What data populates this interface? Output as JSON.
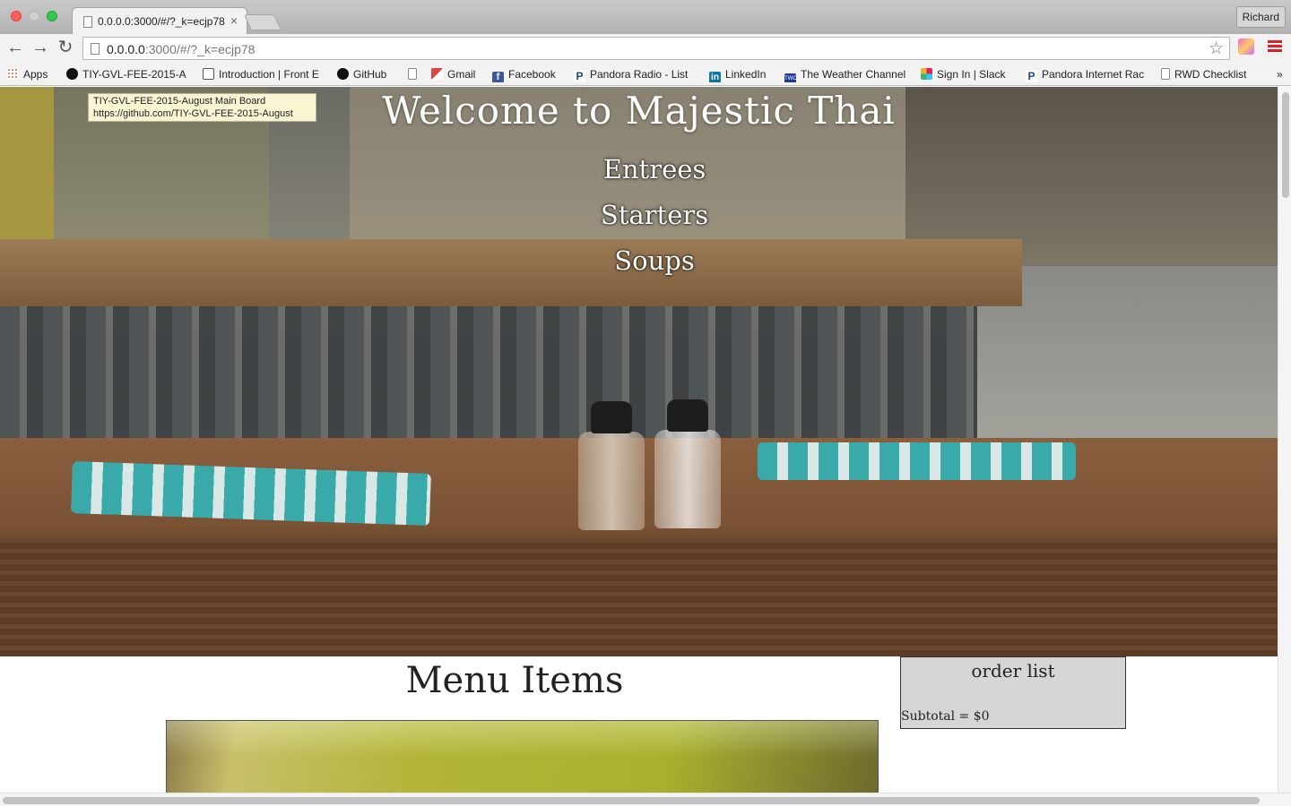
{
  "browser": {
    "tab": {
      "title": "0.0.0.0:3000/#/?_k=ecjp78",
      "close": "×"
    },
    "profile": "Richard",
    "url": {
      "host": "0.0.0.0",
      "path": ":3000/#/?_k=ecjp78"
    },
    "bookmarks": [
      {
        "label": "Apps",
        "icon": "apps-icon"
      },
      {
        "label": "TIY-GVL-FEE-2015-A",
        "icon": "github-icon"
      },
      {
        "label": "Introduction | Front E",
        "icon": "book-icon"
      },
      {
        "label": "GitHub",
        "icon": "github-icon"
      },
      {
        "label": "",
        "icon": "page-icon"
      },
      {
        "label": "Gmail",
        "icon": "gmail-icon"
      },
      {
        "label": "Facebook",
        "icon": "facebook-icon"
      },
      {
        "label": "Pandora Radio - List",
        "icon": "pandora-icon"
      },
      {
        "label": "LinkedIn",
        "icon": "linkedin-icon"
      },
      {
        "label": "The Weather Channel",
        "icon": "weather-channel-icon"
      },
      {
        "label": "Sign In | Slack",
        "icon": "slack-icon"
      },
      {
        "label": "Pandora Internet Rac",
        "icon": "pandora-icon"
      },
      {
        "label": "RWD Checklist",
        "icon": "page-icon"
      }
    ],
    "bookmarks_overflow": "»",
    "tooltip": {
      "line1": "TIY-GVL-FEE-2015-August Main Board",
      "line2": "https://github.com/TIY-GVL-FEE-2015-August"
    }
  },
  "page": {
    "hero_title": "Welcome to Majestic Thai",
    "nav": [
      "Entrees",
      "Starters",
      "Soups"
    ],
    "menu_title": "Menu Items",
    "order": {
      "title": "order list",
      "subtotal": "Subtotal = $0"
    }
  },
  "colors": {
    "traffic_red": "#fc605c",
    "traffic_green": "#34c84a",
    "menu_accent": "#d5232f",
    "order_box_bg": "#d6d6d6"
  }
}
